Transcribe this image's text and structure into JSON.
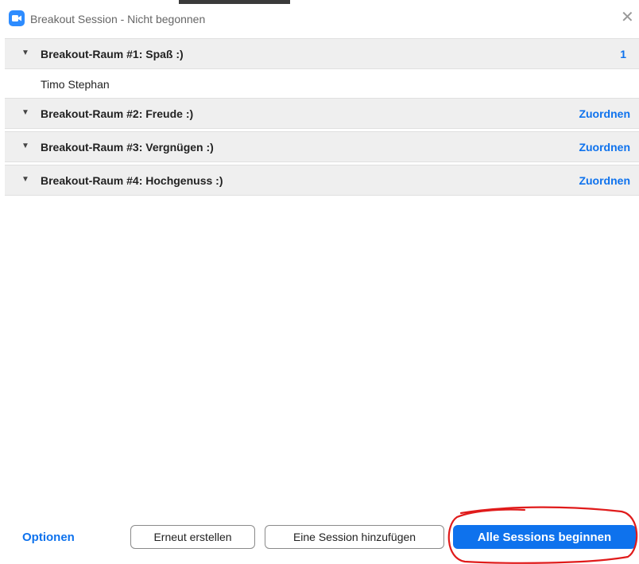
{
  "window": {
    "title": "Breakout Session - Nicht begonnen"
  },
  "rooms": [
    {
      "name": "Breakout-Raum #1: Spaß :)",
      "action": "1",
      "members": [
        "Timo Stephan"
      ]
    },
    {
      "name": "Breakout-Raum #2: Freude :)",
      "action": "Zuordnen"
    },
    {
      "name": "Breakout-Raum #3: Vergnügen :)",
      "action": "Zuordnen"
    },
    {
      "name": "Breakout-Raum #4: Hochgenuss :)",
      "action": "Zuordnen"
    }
  ],
  "footer": {
    "options": "Optionen",
    "recreate": "Erneut erstellen",
    "add_session": "Eine Session hinzufügen",
    "start_all": "Alle Sessions beginnen"
  },
  "colors": {
    "accent": "#0e72ed",
    "annotation": "#e01b1b"
  }
}
